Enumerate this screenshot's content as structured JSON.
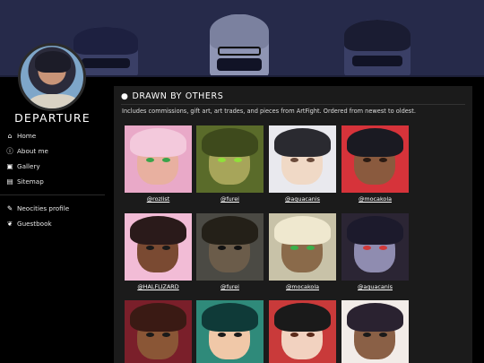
{
  "site": {
    "title": "DEPARTURE"
  },
  "nav": {
    "items": [
      {
        "label": "Home",
        "icon": "home-icon",
        "glyph": "⌂"
      },
      {
        "label": "About me",
        "icon": "info-icon",
        "glyph": "ⓘ"
      },
      {
        "label": "Gallery",
        "icon": "image-icon",
        "glyph": "▣"
      }
    ],
    "sitemap": {
      "label": "Sitemap",
      "icon": "sitemap-icon",
      "glyph": "▤"
    },
    "external": [
      {
        "label": "Neocities profile",
        "icon": "neocities-icon",
        "glyph": "✎"
      },
      {
        "label": "Guestbook",
        "icon": "leaf-icon",
        "glyph": "❦"
      }
    ]
  },
  "section": {
    "title": "DRAWN BY OTHERS",
    "icon": "palette-icon",
    "description": "Includes commissions, gift art, art trades, and pieces from ArtFight. Ordered from newest to oldest."
  },
  "gallery": [
    {
      "artist": "@rozlist",
      "bg": "#e9a9c8",
      "skin": "#e8b0a0",
      "hair": "#f3c9dc",
      "eye": "#3aa34a"
    },
    {
      "artist": "@furei",
      "bg": "#5a6b2a",
      "skin": "#a7a55a",
      "hair": "#3e4a1c",
      "eye": "#8fe03a"
    },
    {
      "artist": "@aquacanis",
      "bg": "#e9e9ee",
      "skin": "#f0d9c6",
      "hair": "#2a2a30",
      "eye": "#6a4a3a"
    },
    {
      "artist": "@mocakola",
      "bg": "#d6333a",
      "skin": "#8a5a3e",
      "hair": "#1a1a22",
      "eye": "#2a1a12"
    },
    {
      "artist": "@HALFLIZARD",
      "bg": "#f2bcd6",
      "skin": "#7a4a32",
      "hair": "#2a1a1a",
      "eye": "#1a1a1a"
    },
    {
      "artist": "@furei",
      "bg": "#4b4a44",
      "skin": "#6b5c4a",
      "hair": "#242018",
      "eye": "#111111"
    },
    {
      "artist": "@mocakola",
      "bg": "#c8c2a8",
      "skin": "#8a6a4a",
      "hair": "#efe8cf",
      "eye": "#3ab04a"
    },
    {
      "artist": "@aquacanis",
      "bg": "#2b2534",
      "skin": "#8f8cb0",
      "hair": "#1c1a2c",
      "eye": "#d03a3a"
    },
    {
      "artist": "",
      "bg": "#7a1f2a",
      "skin": "#8a5636",
      "hair": "#3a1a14",
      "eye": "#1a1a1a"
    },
    {
      "artist": "",
      "bg": "#2f8a7a",
      "skin": "#f0c8a8",
      "hair": "#0f3a38",
      "eye": "#1a1a1a"
    },
    {
      "artist": "",
      "bg": "#c93a3a",
      "skin": "#f2d2c0",
      "hair": "#1a1a1a",
      "eye": "#5a2a1a"
    },
    {
      "artist": "",
      "bg": "#f2ece8",
      "skin": "#8a6046",
      "hair": "#2a2230",
      "eye": "#1a1a1a"
    }
  ]
}
